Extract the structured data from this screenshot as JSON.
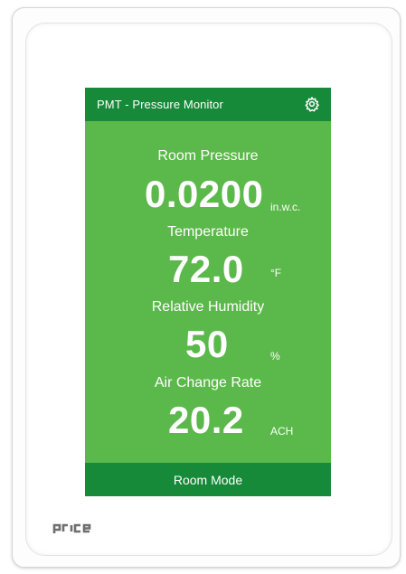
{
  "screen": {
    "title": "PMT - Pressure Monitor",
    "settings_icon": "gear-icon",
    "footer_button": "Room Mode"
  },
  "readings": [
    {
      "label": "Room Pressure",
      "value": "0.0200",
      "unit": "in.w.c."
    },
    {
      "label": "Temperature",
      "value": "72.0",
      "unit": "°F"
    },
    {
      "label": "Relative Humidity",
      "value": "50",
      "unit": "%"
    },
    {
      "label": "Air Change Rate",
      "value": "20.2",
      "unit": "ACH"
    }
  ],
  "brand": {
    "logo_text": "price"
  },
  "colors": {
    "screen_background": "#5bb84a",
    "bar_background": "#178a3a",
    "text": "#ffffff",
    "logo": "#6e6e6e"
  }
}
